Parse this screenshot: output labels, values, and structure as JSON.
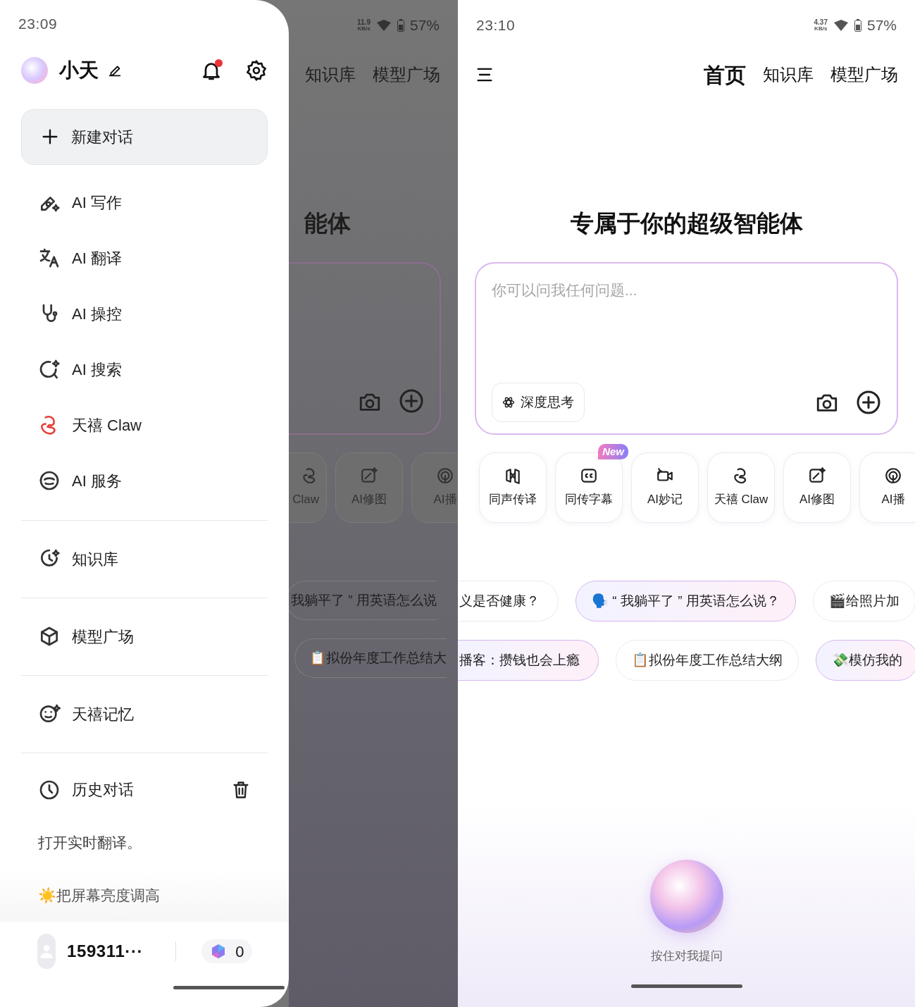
{
  "left_screen": {
    "status_bar": {
      "time": "23:09",
      "speed_value": "11.9",
      "speed_unit": "KB/s",
      "battery": "57%"
    },
    "drawer": {
      "assistant_name": "小天",
      "has_notification": true,
      "new_chat": "新建对话",
      "groups": [
        {
          "items": [
            {
              "label": "AI 写作",
              "kind": "plain"
            },
            {
              "label": "AI 翻译",
              "kind": "plain"
            },
            {
              "label": "AI 操控",
              "kind": "plain"
            },
            {
              "label": "AI 搜索",
              "kind": "plain"
            },
            {
              "label": "天禧 Claw",
              "kind": "accent"
            },
            {
              "label": "AI 服务",
              "kind": "plain"
            }
          ]
        },
        {
          "items": [
            {
              "label": "知识库",
              "kind": "plain"
            }
          ]
        },
        {
          "items": [
            {
              "label": "模型广场",
              "kind": "plain"
            }
          ]
        },
        {
          "items": [
            {
              "label": "天禧记忆",
              "kind": "plain"
            }
          ]
        }
      ],
      "history": {
        "label": "历史对话"
      },
      "recent": [
        "打开实时翻译。",
        "☀️把屏幕亮度调高"
      ],
      "account": {
        "user": "159311···",
        "points": "0"
      }
    },
    "background": {
      "tabs": [
        "知识库",
        "模型广场"
      ],
      "heading": "能体",
      "tiles": [
        "Claw",
        "AI修图",
        "AI播"
      ],
      "chip_rows": [
        [
          "我躺平了 ” 用英语怎么说"
        ],
        [
          "📋拟份年度工作总结大"
        ]
      ]
    }
  },
  "right_screen": {
    "status_bar": {
      "time": "23:10",
      "speed_value": "4.37",
      "speed_unit": "KB/s",
      "battery": "57%"
    },
    "tabs": [
      {
        "label": "首页",
        "selected": true
      },
      {
        "label": "知识库",
        "selected": false
      },
      {
        "label": "模型广场",
        "selected": false
      }
    ],
    "heading": "专属于你的超级智能体",
    "input": {
      "placeholder": "你可以问我任何问题...",
      "deep_think": "深度思考"
    },
    "tiles": [
      {
        "label": "同声传译"
      },
      {
        "label": "同传字幕",
        "badge": "New"
      },
      {
        "label": "AI妙记"
      },
      {
        "label": "天禧 Claw"
      },
      {
        "label": "AI修图"
      },
      {
        "label": "AI播"
      }
    ],
    "suggestion_rows": [
      [
        {
          "text": "义是否健康？",
          "highlighted": false
        },
        {
          "text": "🗣️ “ 我躺平了 ” 用英语怎么说？",
          "highlighted": true
        },
        {
          "text": "🎬给照片加",
          "highlighted": false
        }
      ],
      [
        {
          "text": "播客：攒钱也会上瘾",
          "highlighted": true
        },
        {
          "text": "📋拟份年度工作总结大纲",
          "highlighted": false
        },
        {
          "text": "💸模仿我的",
          "highlighted": true
        }
      ]
    ],
    "voice_hint": "按住对我提问"
  }
}
